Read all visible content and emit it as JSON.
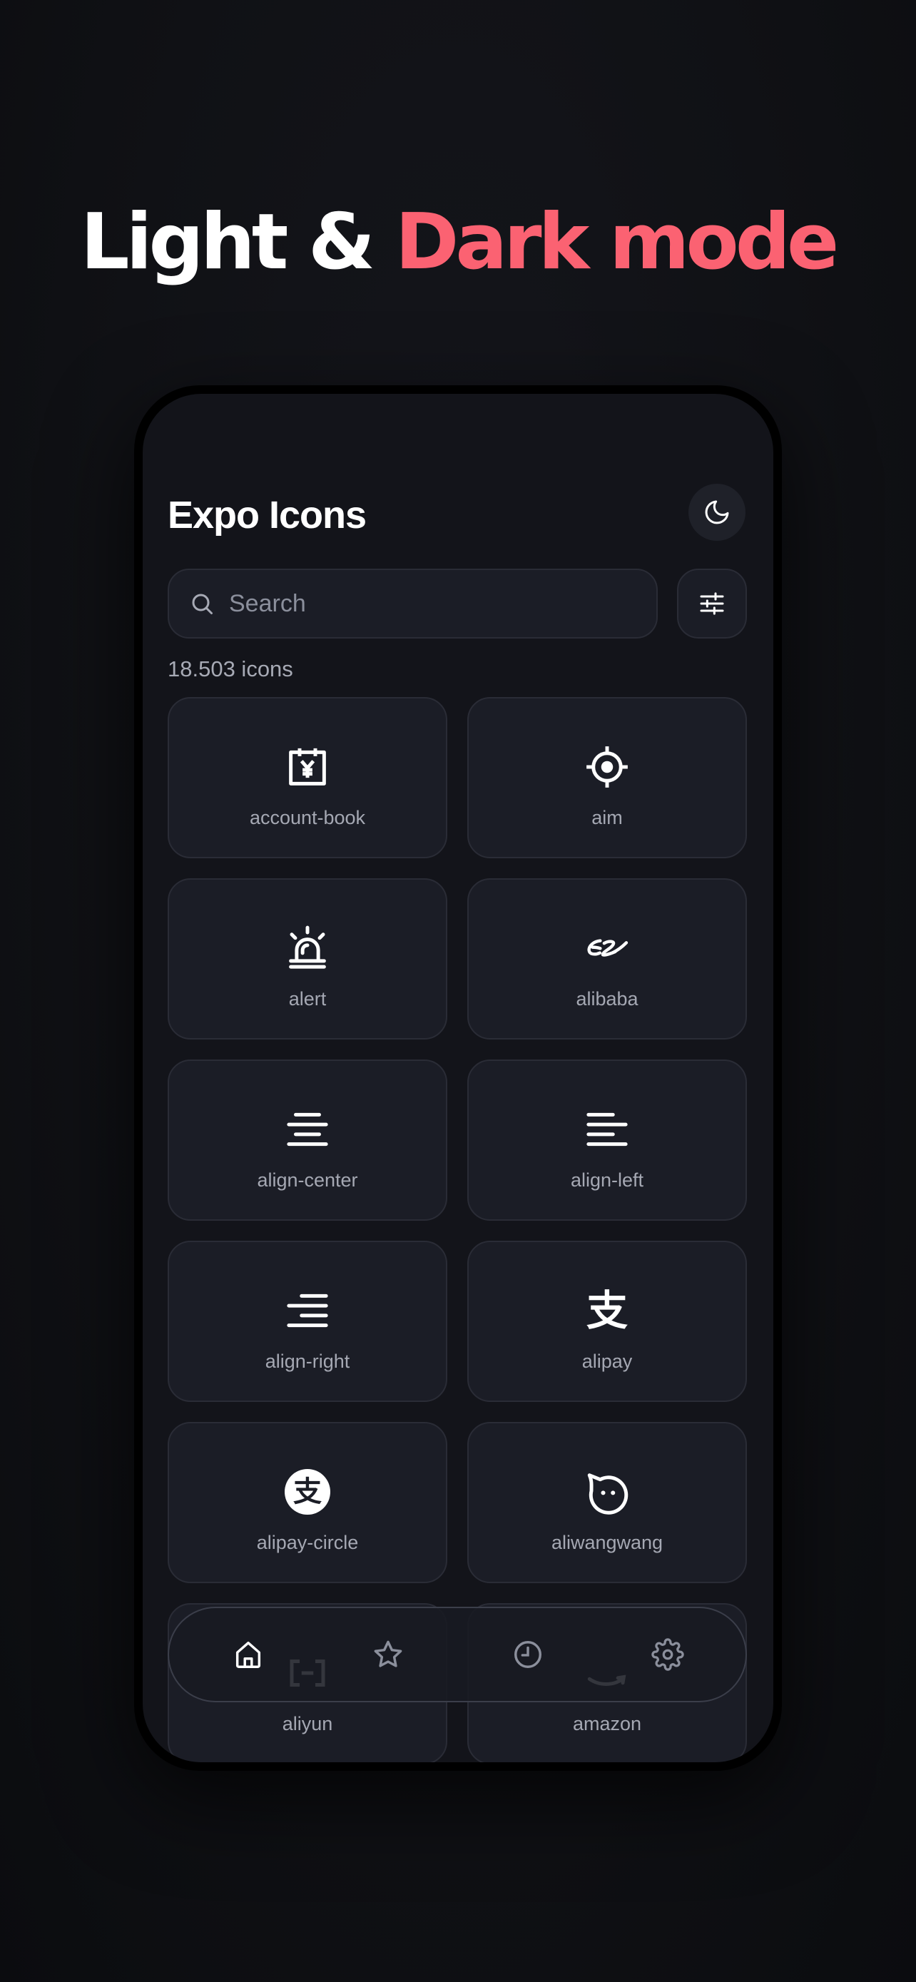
{
  "headline": {
    "part1": "Light &",
    "part2": "Dark mode"
  },
  "app": {
    "title": "Expo Icons",
    "search_placeholder": "Search",
    "icon_count": "18.503 icons"
  },
  "icons": [
    {
      "label": "account-book",
      "icon": "account-book-icon"
    },
    {
      "label": "aim",
      "icon": "aim-icon"
    },
    {
      "label": "alert",
      "icon": "alert-icon"
    },
    {
      "label": "alibaba",
      "icon": "alibaba-icon"
    },
    {
      "label": "align-center",
      "icon": "align-center-icon"
    },
    {
      "label": "align-left",
      "icon": "align-left-icon"
    },
    {
      "label": "align-right",
      "icon": "align-right-icon"
    },
    {
      "label": "alipay",
      "icon": "alipay-icon"
    },
    {
      "label": "alipay-circle",
      "icon": "alipay-circle-icon"
    },
    {
      "label": "aliwangwang",
      "icon": "aliwangwang-icon"
    },
    {
      "label": "aliyun",
      "icon": "aliyun-icon"
    },
    {
      "label": "amazon",
      "icon": "amazon-icon"
    }
  ],
  "alipay_glyph": "支",
  "tabs": [
    "home-icon",
    "star-icon",
    "clock-icon",
    "gear-icon"
  ],
  "colors": {
    "accent": "#fb6272",
    "background": "#101115",
    "card": "#1b1d26",
    "card_border": "#2a2c36",
    "active_icon": "#ffffff",
    "inactive_icon": "#8b8f9c"
  }
}
